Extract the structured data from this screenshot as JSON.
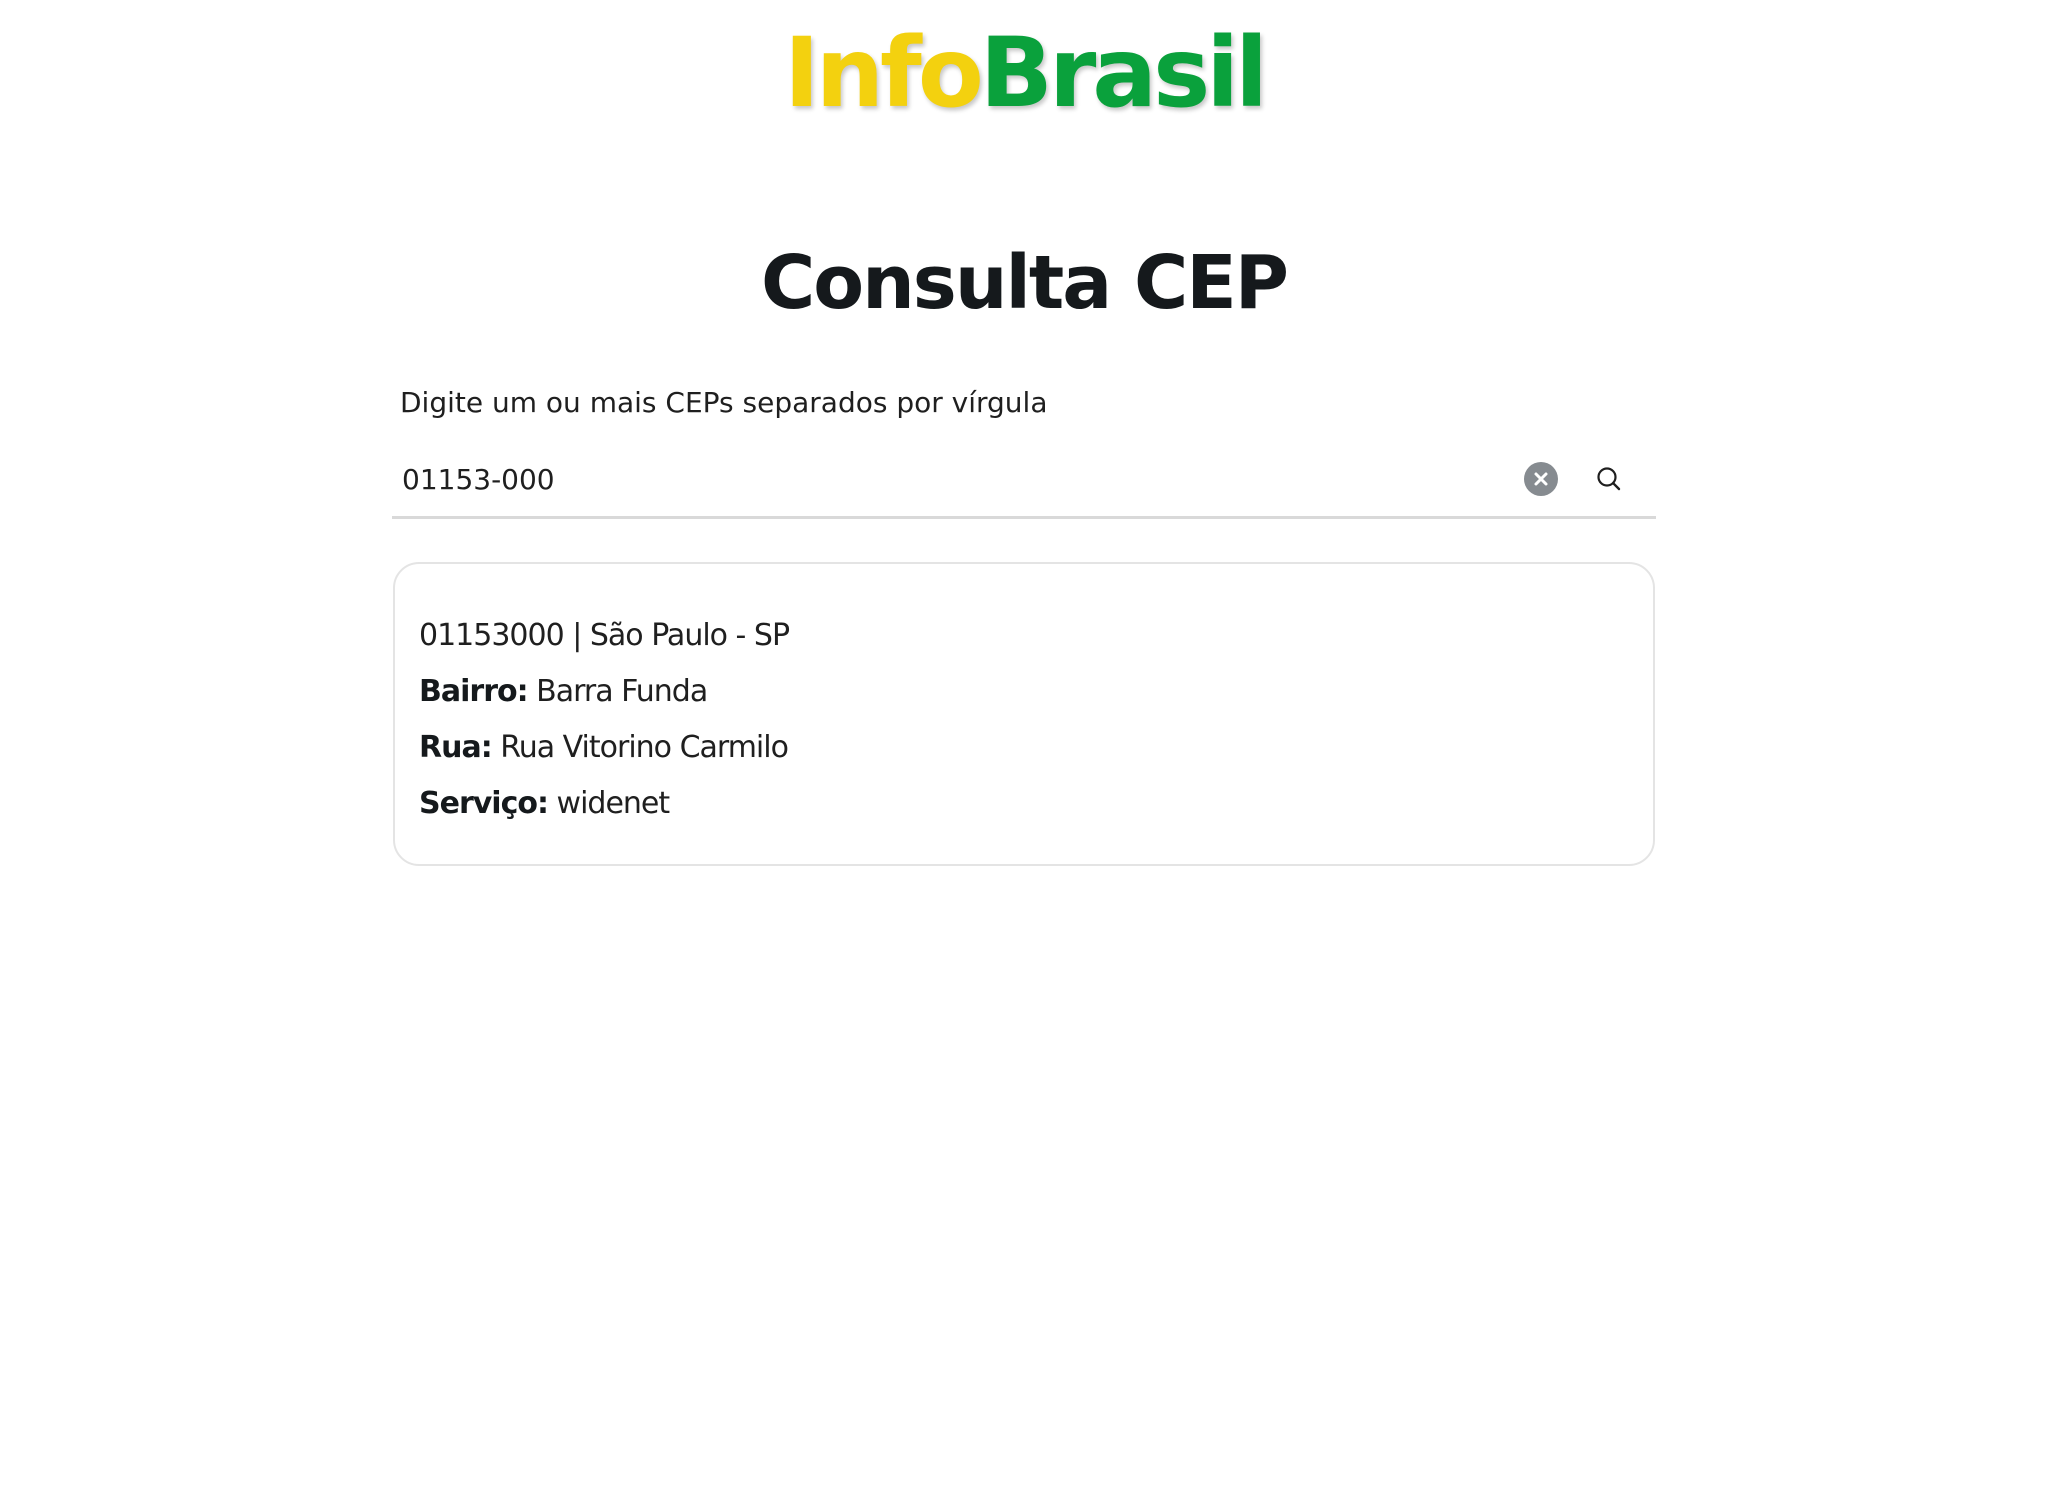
{
  "logo": {
    "part1": "Info",
    "part2": "Brasil",
    "colors": {
      "part1": "#f3d10f",
      "part2": "#0aa13c"
    }
  },
  "page": {
    "title": "Consulta CEP"
  },
  "search": {
    "label": "Digite um ou mais CEPs separados por vírgula",
    "value": "01153-000",
    "clear_icon": "close-circle-icon",
    "search_icon": "magnifier-icon"
  },
  "result": {
    "header": "01153000 | São Paulo - SP",
    "bairro_label": "Bairro:",
    "bairro_value": "Barra Funda",
    "rua_label": "Rua:",
    "rua_value": "Rua Vitorino Carmilo",
    "servico_label": "Serviço:",
    "servico_value": "widenet"
  }
}
